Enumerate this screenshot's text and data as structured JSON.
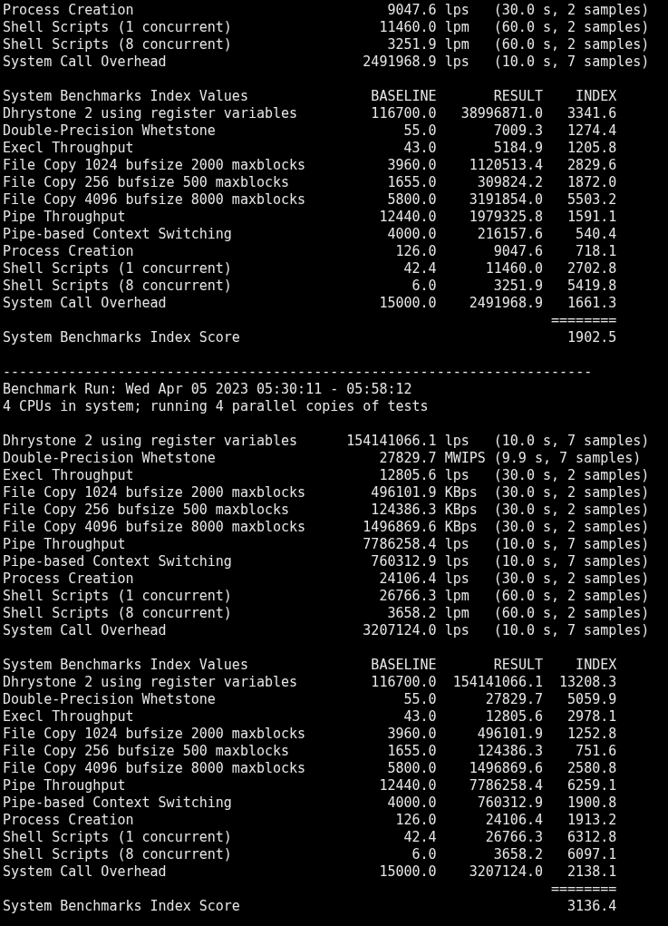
{
  "terminal": {
    "sections": [
      {
        "kind": "results",
        "rows": [
          {
            "name": "Process Creation",
            "value": "9047.6",
            "unit": "lps",
            "detail": "(30.0 s, 2 samples)"
          },
          {
            "name": "Shell Scripts (1 concurrent)",
            "value": "11460.0",
            "unit": "lpm",
            "detail": "(60.0 s, 2 samples)"
          },
          {
            "name": "Shell Scripts (8 concurrent)",
            "value": "3251.9",
            "unit": "lpm",
            "detail": "(60.0 s, 2 samples)"
          },
          {
            "name": "System Call Overhead",
            "value": "2491968.9",
            "unit": "lps",
            "detail": "(10.0 s, 7 samples)"
          }
        ]
      },
      {
        "kind": "index",
        "title": "System Benchmarks Index Values",
        "columns": [
          "BASELINE",
          "RESULT",
          "INDEX"
        ],
        "rows": [
          {
            "name": "Dhrystone 2 using register variables",
            "baseline": "116700.0",
            "result": "38996871.0",
            "index": "3341.6"
          },
          {
            "name": "Double-Precision Whetstone",
            "baseline": "55.0",
            "result": "7009.3",
            "index": "1274.4"
          },
          {
            "name": "Execl Throughput",
            "baseline": "43.0",
            "result": "5184.9",
            "index": "1205.8"
          },
          {
            "name": "File Copy 1024 bufsize 2000 maxblocks",
            "baseline": "3960.0",
            "result": "1120513.4",
            "index": "2829.6"
          },
          {
            "name": "File Copy 256 bufsize 500 maxblocks",
            "baseline": "1655.0",
            "result": "309824.2",
            "index": "1872.0"
          },
          {
            "name": "File Copy 4096 bufsize 8000 maxblocks",
            "baseline": "5800.0",
            "result": "3191854.0",
            "index": "5503.2"
          },
          {
            "name": "Pipe Throughput",
            "baseline": "12440.0",
            "result": "1979325.8",
            "index": "1591.1"
          },
          {
            "name": "Pipe-based Context Switching",
            "baseline": "4000.0",
            "result": "216157.6",
            "index": "540.4"
          },
          {
            "name": "Process Creation",
            "baseline": "126.0",
            "result": "9047.6",
            "index": "718.1"
          },
          {
            "name": "Shell Scripts (1 concurrent)",
            "baseline": "42.4",
            "result": "11460.0",
            "index": "2702.8"
          },
          {
            "name": "Shell Scripts (8 concurrent)",
            "baseline": "6.0",
            "result": "3251.9",
            "index": "5419.8"
          },
          {
            "name": "System Call Overhead",
            "baseline": "15000.0",
            "result": "2491968.9",
            "index": "1661.3"
          }
        ],
        "rule": "========",
        "score_label": "System Benchmarks Index Score",
        "score": "1902.5"
      },
      {
        "kind": "run_info",
        "rule": "------------------------------------------------------------------------",
        "lines": [
          "Benchmark Run: Wed Apr 05 2023 05:30:11 - 05:58:12",
          "4 CPUs in system; running 4 parallel copies of tests"
        ]
      },
      {
        "kind": "results",
        "rows": [
          {
            "name": "Dhrystone 2 using register variables",
            "value": "154141066.1",
            "unit": "lps",
            "detail": "(10.0 s, 7 samples)"
          },
          {
            "name": "Double-Precision Whetstone",
            "value": "27829.7",
            "unit": "MWIPS",
            "detail": "(9.9 s, 7 samples)"
          },
          {
            "name": "Execl Throughput",
            "value": "12805.6",
            "unit": "lps",
            "detail": "(30.0 s, 2 samples)"
          },
          {
            "name": "File Copy 1024 bufsize 2000 maxblocks",
            "value": "496101.9",
            "unit": "KBps",
            "detail": "(30.0 s, 2 samples)"
          },
          {
            "name": "File Copy 256 bufsize 500 maxblocks",
            "value": "124386.3",
            "unit": "KBps",
            "detail": "(30.0 s, 2 samples)"
          },
          {
            "name": "File Copy 4096 bufsize 8000 maxblocks",
            "value": "1496869.6",
            "unit": "KBps",
            "detail": "(30.0 s, 2 samples)"
          },
          {
            "name": "Pipe Throughput",
            "value": "7786258.4",
            "unit": "lps",
            "detail": "(10.0 s, 7 samples)"
          },
          {
            "name": "Pipe-based Context Switching",
            "value": "760312.9",
            "unit": "lps",
            "detail": "(10.0 s, 7 samples)"
          },
          {
            "name": "Process Creation",
            "value": "24106.4",
            "unit": "lps",
            "detail": "(30.0 s, 2 samples)"
          },
          {
            "name": "Shell Scripts (1 concurrent)",
            "value": "26766.3",
            "unit": "lpm",
            "detail": "(60.0 s, 2 samples)"
          },
          {
            "name": "Shell Scripts (8 concurrent)",
            "value": "3658.2",
            "unit": "lpm",
            "detail": "(60.0 s, 2 samples)"
          },
          {
            "name": "System Call Overhead",
            "value": "3207124.0",
            "unit": "lps",
            "detail": "(10.0 s, 7 samples)"
          }
        ]
      },
      {
        "kind": "index",
        "title": "System Benchmarks Index Values",
        "columns": [
          "BASELINE",
          "RESULT",
          "INDEX"
        ],
        "rows": [
          {
            "name": "Dhrystone 2 using register variables",
            "baseline": "116700.0",
            "result": "154141066.1",
            "index": "13208.3"
          },
          {
            "name": "Double-Precision Whetstone",
            "baseline": "55.0",
            "result": "27829.7",
            "index": "5059.9"
          },
          {
            "name": "Execl Throughput",
            "baseline": "43.0",
            "result": "12805.6",
            "index": "2978.1"
          },
          {
            "name": "File Copy 1024 bufsize 2000 maxblocks",
            "baseline": "3960.0",
            "result": "496101.9",
            "index": "1252.8"
          },
          {
            "name": "File Copy 256 bufsize 500 maxblocks",
            "baseline": "1655.0",
            "result": "124386.3",
            "index": "751.6"
          },
          {
            "name": "File Copy 4096 bufsize 8000 maxblocks",
            "baseline": "5800.0",
            "result": "1496869.6",
            "index": "2580.8"
          },
          {
            "name": "Pipe Throughput",
            "baseline": "12440.0",
            "result": "7786258.4",
            "index": "6259.1"
          },
          {
            "name": "Pipe-based Context Switching",
            "baseline": "4000.0",
            "result": "760312.9",
            "index": "1900.8"
          },
          {
            "name": "Process Creation",
            "baseline": "126.0",
            "result": "24106.4",
            "index": "1913.2"
          },
          {
            "name": "Shell Scripts (1 concurrent)",
            "baseline": "42.4",
            "result": "26766.3",
            "index": "6312.8"
          },
          {
            "name": "Shell Scripts (8 concurrent)",
            "baseline": "6.0",
            "result": "3658.2",
            "index": "6097.1"
          },
          {
            "name": "System Call Overhead",
            "baseline": "15000.0",
            "result": "3207124.0",
            "index": "2138.1"
          }
        ],
        "rule": "========",
        "score_label": "System Benchmarks Index Score",
        "score": "3136.4"
      }
    ]
  }
}
